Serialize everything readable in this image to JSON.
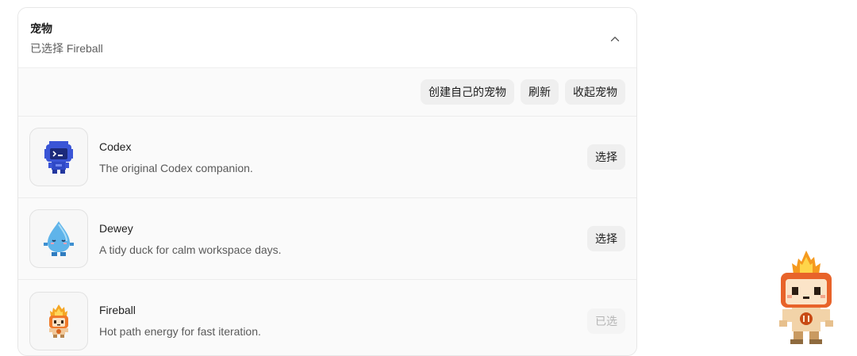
{
  "panel": {
    "title": "宠物",
    "subtitle": "已选择 Fireball",
    "collapse_icon": "chevron-up-icon"
  },
  "toolbar": {
    "create_label": "创建自己的宠物",
    "refresh_label": "刷新",
    "stow_label": "收起宠物"
  },
  "pets": [
    {
      "name": "Codex",
      "description": "The original Codex companion.",
      "action_label": "选择",
      "selected": false,
      "icon": "codex-cloud-robot-icon"
    },
    {
      "name": "Dewey",
      "description": "A tidy duck for calm workspace days.",
      "action_label": "选择",
      "selected": false,
      "icon": "dewey-droplet-icon"
    },
    {
      "name": "Fireball",
      "description": "Hot path energy for fast iteration.",
      "action_label": "已选",
      "selected": true,
      "icon": "fireball-icon"
    }
  ],
  "floating_pet": {
    "icon": "fireball-pet-icon"
  },
  "colors": {
    "codex_blue": "#3a55d6",
    "dewey_blue": "#5fb4ea",
    "fireball_orange": "#f07a2a"
  }
}
